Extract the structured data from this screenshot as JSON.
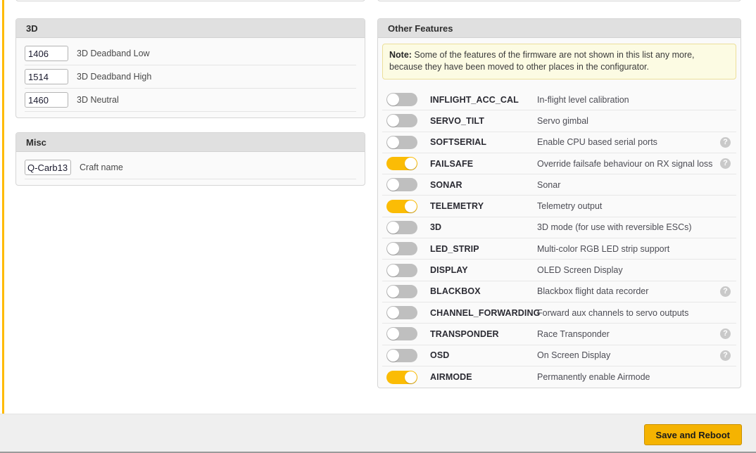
{
  "theme": {
    "accent": "#f5b301",
    "toggle_on": "#fbbc05",
    "toggle_off": "#bfbfbf",
    "panel_header_bg": "#e0e0e0",
    "note_bg": "#fcfbe3",
    "rail": "#ffbb00"
  },
  "panels": {
    "three_d": {
      "title": "3D",
      "fields": [
        {
          "value": "1406",
          "label": "3D Deadband Low"
        },
        {
          "value": "1514",
          "label": "3D Deadband High"
        },
        {
          "value": "1460",
          "label": "3D Neutral"
        }
      ]
    },
    "misc": {
      "title": "Misc",
      "fields": [
        {
          "value": "Q-Carb13",
          "label": "Craft name"
        }
      ]
    },
    "other_features": {
      "title": "Other Features",
      "note_prefix": "Note:",
      "note_text": " Some of the features of the firmware are not shown in this list any more, because they have been moved to other places in the configurator.",
      "features": [
        {
          "name": "INFLIGHT_ACC_CAL",
          "description": "In-flight level calibration",
          "enabled": false,
          "help": false
        },
        {
          "name": "SERVO_TILT",
          "description": "Servo gimbal",
          "enabled": false,
          "help": false
        },
        {
          "name": "SOFTSERIAL",
          "description": "Enable CPU based serial ports",
          "enabled": false,
          "help": true
        },
        {
          "name": "FAILSAFE",
          "description": "Override failsafe behaviour on RX signal loss",
          "enabled": true,
          "help": true
        },
        {
          "name": "SONAR",
          "description": "Sonar",
          "enabled": false,
          "help": false
        },
        {
          "name": "TELEMETRY",
          "description": "Telemetry output",
          "enabled": true,
          "help": false
        },
        {
          "name": "3D",
          "description": "3D mode (for use with reversible ESCs)",
          "enabled": false,
          "help": false
        },
        {
          "name": "LED_STRIP",
          "description": "Multi-color RGB LED strip support",
          "enabled": false,
          "help": false
        },
        {
          "name": "DISPLAY",
          "description": "OLED Screen Display",
          "enabled": false,
          "help": false
        },
        {
          "name": "BLACKBOX",
          "description": "Blackbox flight data recorder",
          "enabled": false,
          "help": true
        },
        {
          "name": "CHANNEL_FORWARDING",
          "description": "Forward aux channels to servo outputs",
          "enabled": false,
          "help": false
        },
        {
          "name": "TRANSPONDER",
          "description": "Race Transponder",
          "enabled": false,
          "help": true
        },
        {
          "name": "OSD",
          "description": "On Screen Display",
          "enabled": false,
          "help": true
        },
        {
          "name": "AIRMODE",
          "description": "Permanently enable Airmode",
          "enabled": true,
          "help": false
        }
      ]
    }
  },
  "footer": {
    "save_label": "Save and Reboot"
  },
  "icons": {
    "help": "?"
  }
}
